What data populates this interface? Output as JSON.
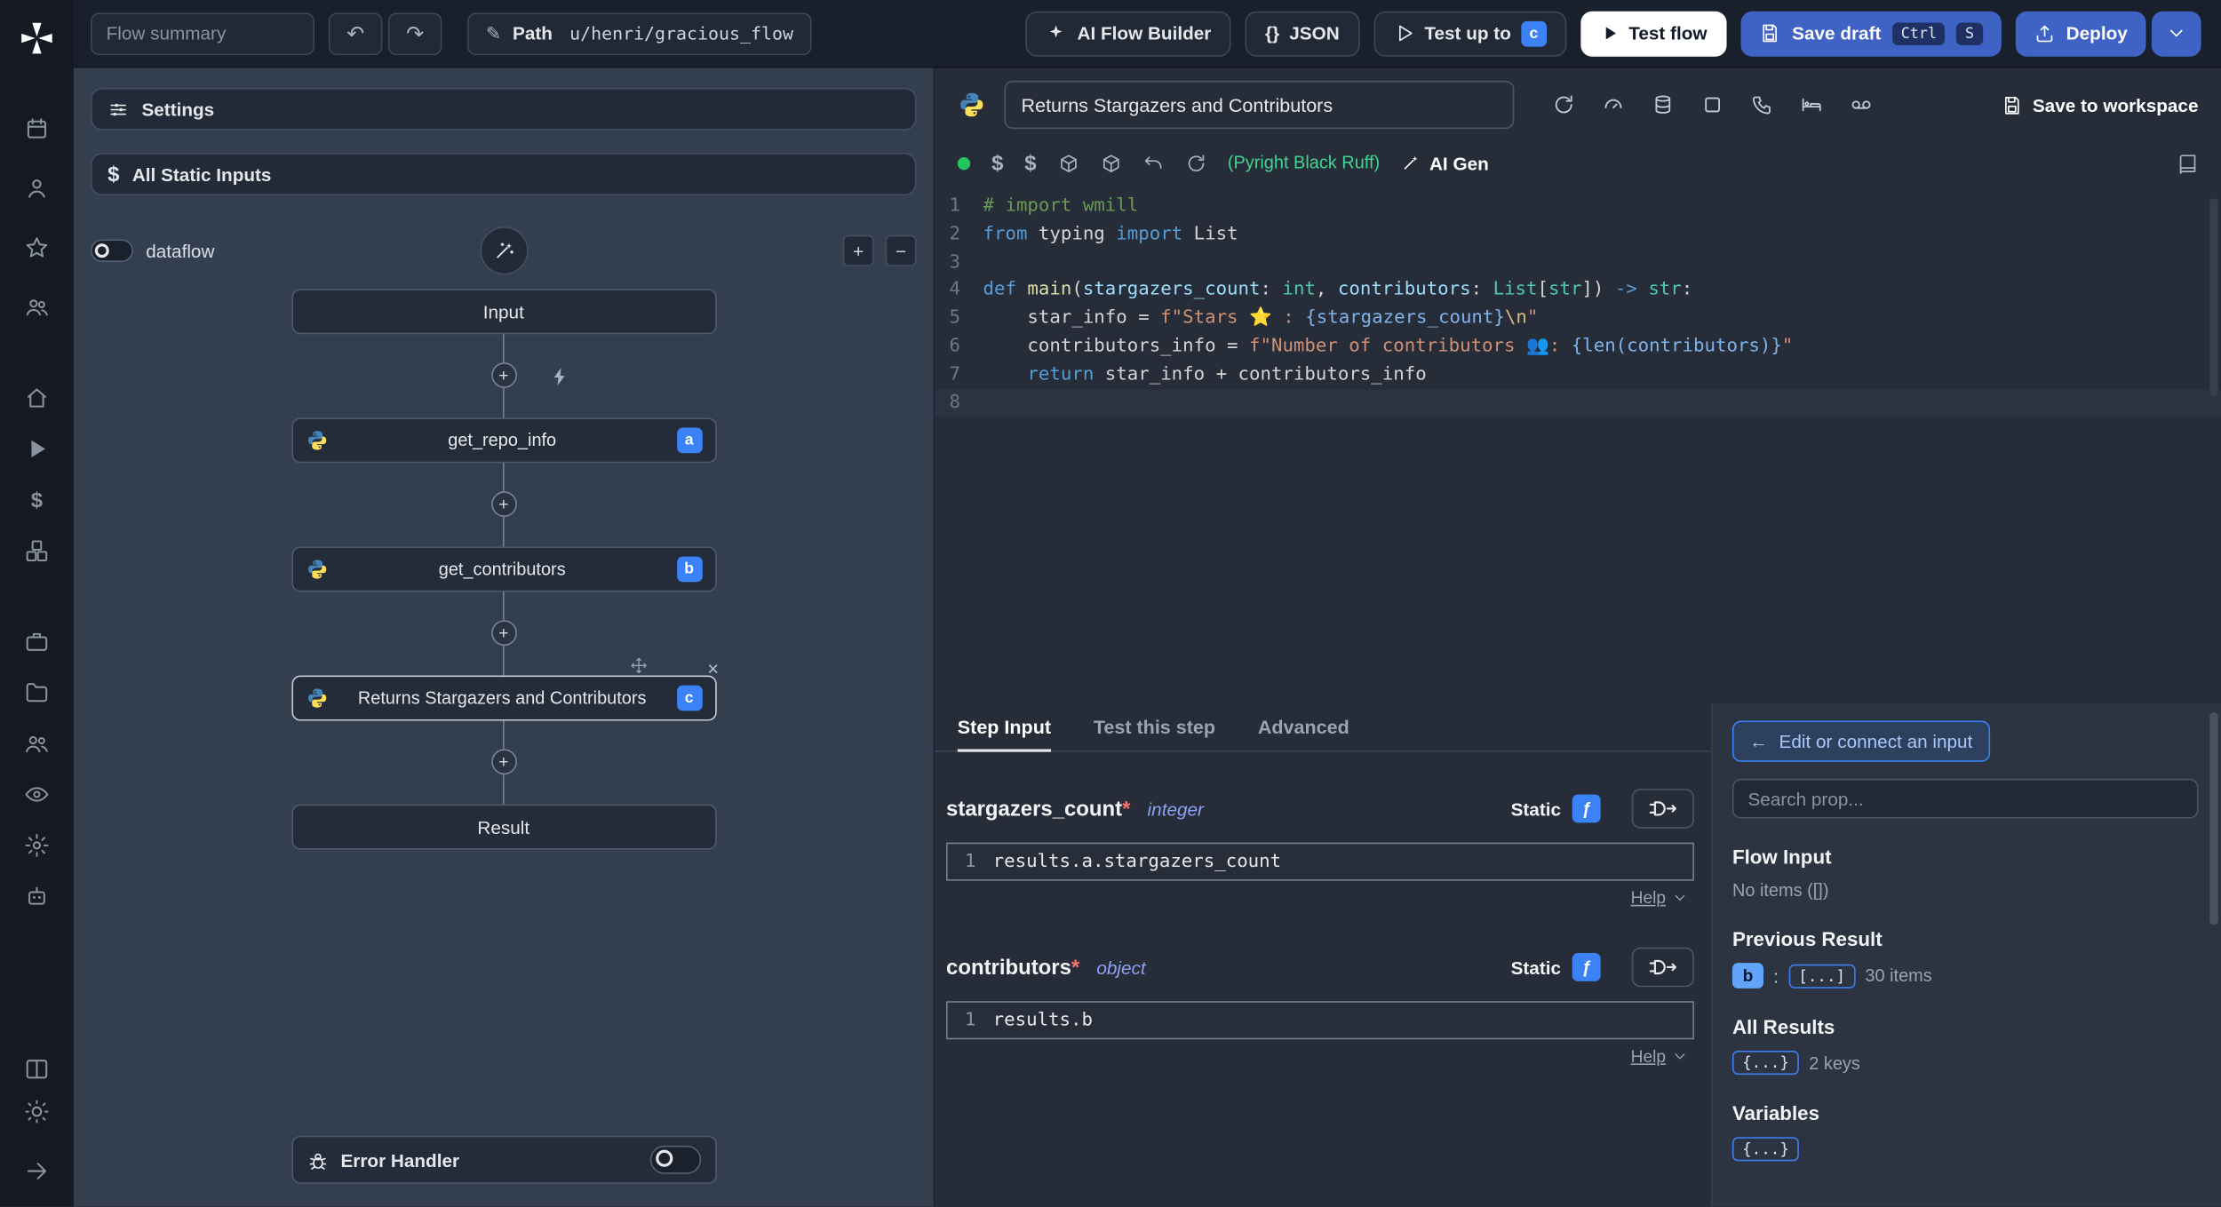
{
  "icons": {
    "undo": "↶",
    "redo": "↷",
    "pencil": "✎",
    "dollar": "$",
    "plus": "+",
    "minus": "−",
    "close": "×",
    "fx": "ƒ",
    "arrow_left": "←",
    "braces": "{}"
  },
  "topbar": {
    "flow_summary_placeholder": "Flow summary",
    "path_label": "Path",
    "path_value": "u/henri/gracious_flow",
    "buttons": {
      "ai_flow_builder": "AI Flow Builder",
      "json": "JSON",
      "test_up_to": "Test up to",
      "test_up_to_badge": "c",
      "test_flow": "Test flow",
      "save_draft": "Save draft",
      "kbd_ctrl": "Ctrl",
      "kbd_s": "S",
      "deploy": "Deploy"
    }
  },
  "flow_panel": {
    "settings": "Settings",
    "all_static_inputs": "All Static Inputs",
    "dataflow": "dataflow",
    "input_node": "Input",
    "steps": [
      {
        "label": "get_repo_info",
        "badge": "a"
      },
      {
        "label": "get_contributors",
        "badge": "b"
      },
      {
        "label": "Returns Stargazers and Contributors",
        "badge": "c"
      }
    ],
    "result_node": "Result",
    "error_handler": "Error Handler"
  },
  "editor": {
    "title": "Returns Stargazers and Contributors",
    "save_to_workspace": "Save to workspace",
    "lint_status": "(Pyright Black Ruff)",
    "ai_gen": "AI Gen",
    "current_line": 8,
    "code": [
      [
        {
          "c": "comment",
          "t": "# import wmill"
        }
      ],
      [
        {
          "c": "kw",
          "t": "from"
        },
        {
          "c": "plain",
          "t": " typing "
        },
        {
          "c": "kw",
          "t": "import"
        },
        {
          "c": "plain",
          "t": " List"
        }
      ],
      [],
      [
        {
          "c": "kw",
          "t": "def"
        },
        {
          "c": "plain",
          "t": " "
        },
        {
          "c": "fn",
          "t": "main"
        },
        {
          "c": "plain",
          "t": "("
        },
        {
          "c": "param",
          "t": "stargazers_count"
        },
        {
          "c": "plain",
          "t": ": "
        },
        {
          "c": "type",
          "t": "int"
        },
        {
          "c": "plain",
          "t": ", "
        },
        {
          "c": "param",
          "t": "contributors"
        },
        {
          "c": "plain",
          "t": ": "
        },
        {
          "c": "type",
          "t": "List"
        },
        {
          "c": "plain",
          "t": "["
        },
        {
          "c": "type",
          "t": "str"
        },
        {
          "c": "plain",
          "t": "]"
        },
        {
          "c": "plain",
          "t": ") "
        },
        {
          "c": "kw",
          "t": "->"
        },
        {
          "c": "plain",
          "t": " "
        },
        {
          "c": "type",
          "t": "str"
        },
        {
          "c": "plain",
          "t": ":"
        }
      ],
      [
        {
          "c": "plain",
          "t": "    star_info = "
        },
        {
          "c": "str",
          "t": "f\"Stars ⭐ : "
        },
        {
          "c": "brace",
          "t": "{stargazers_count}"
        },
        {
          "c": "esc",
          "t": "\\n"
        },
        {
          "c": "str",
          "t": "\""
        }
      ],
      [
        {
          "c": "plain",
          "t": "    contributors_info = "
        },
        {
          "c": "str",
          "t": "f\"Number of contributors 👥: "
        },
        {
          "c": "brace",
          "t": "{len(contributors)}"
        },
        {
          "c": "str",
          "t": "\""
        }
      ],
      [
        {
          "c": "plain",
          "t": "    "
        },
        {
          "c": "kw",
          "t": "return"
        },
        {
          "c": "plain",
          "t": " star_info + contributors_info"
        }
      ],
      []
    ]
  },
  "step_panel": {
    "tabs": [
      {
        "label": "Step Input"
      },
      {
        "label": "Test this step"
      },
      {
        "label": "Advanced"
      }
    ],
    "static_label": "Static",
    "help_label": "Help",
    "fields": [
      {
        "name": "stargazers_count",
        "required": "*",
        "type": "integer",
        "line": "1",
        "expr": "results.a.stargazers_count"
      },
      {
        "name": "contributors",
        "required": "*",
        "type": "object",
        "line": "1",
        "expr": "results.b"
      }
    ]
  },
  "prop_picker": {
    "connect_button": "Edit or connect an input",
    "search_placeholder": "Search prop...",
    "flow_input": {
      "title": "Flow Input",
      "empty": "No items ([])"
    },
    "previous_result": {
      "title": "Previous Result",
      "badge": "b",
      "colon": ":",
      "value": "[...]",
      "count": "30 items"
    },
    "all_results": {
      "title": "All Results",
      "value": "{...}",
      "count": "2 keys"
    },
    "variables": {
      "title": "Variables",
      "value": "{...}"
    }
  }
}
